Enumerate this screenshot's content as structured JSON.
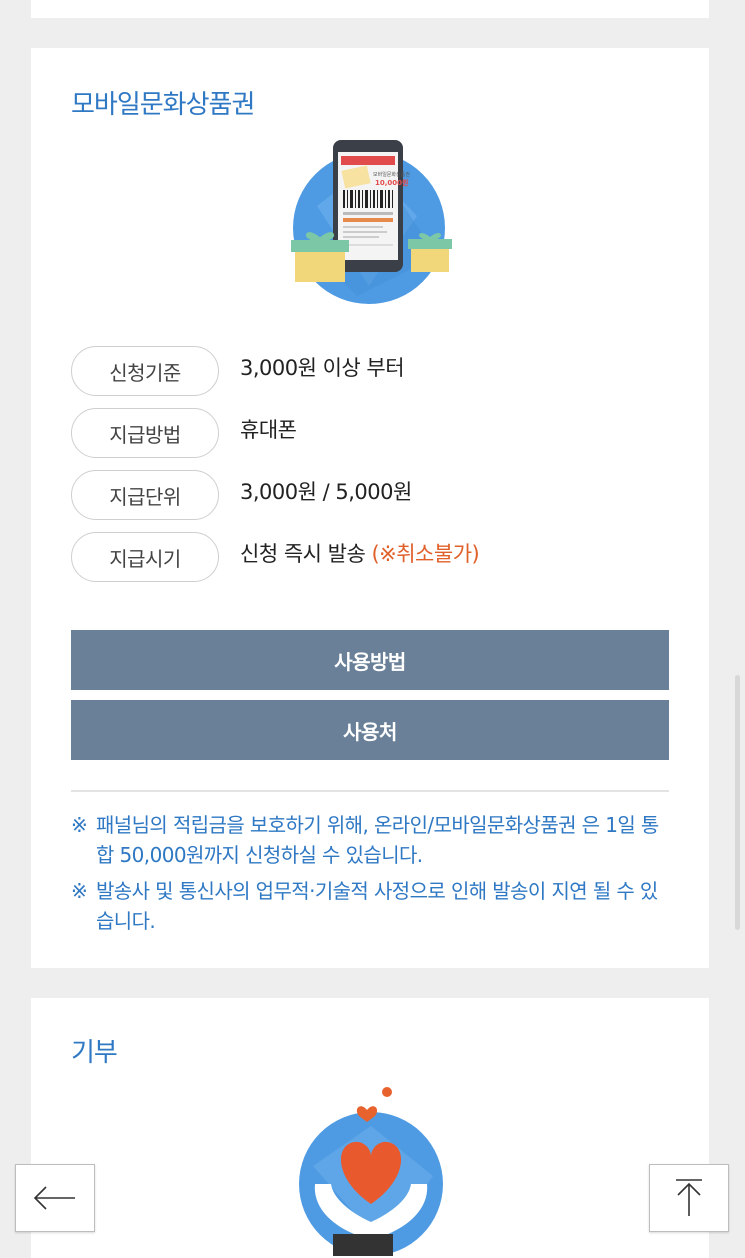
{
  "mobile_gift": {
    "title": "모바일문화상품권",
    "illustration": {
      "icon": "mobile-voucher-illustration",
      "voucher_amount": "10,000원"
    },
    "info": [
      {
        "label": "신청기준",
        "value": "3,000원 이상 부터",
        "note": ""
      },
      {
        "label": "지급방법",
        "value": "휴대폰",
        "note": ""
      },
      {
        "label": "지급단위",
        "value": "3,000원 / 5,000원",
        "note": ""
      },
      {
        "label": "지급시기",
        "value": "신청 즉시 발송 ",
        "note": "(※취소불가)"
      }
    ],
    "buttons": {
      "how_to_use": "사용방법",
      "where_to_use": "사용처"
    },
    "notices": [
      {
        "mark": "※",
        "text": "패널님의 적립금을 보호하기 위해, 온라인/모바일문화상품권 은 1일 통합 50,000원까지 신청하실 수 있습니다."
      },
      {
        "mark": "※",
        "text": "발송사 및 통신사의 업무적·기술적 사정으로 인해 발송이 지연 될 수 있습니다."
      }
    ]
  },
  "donation": {
    "title": "기부",
    "illustration": {
      "icon": "heart-hands-illustration"
    }
  },
  "nav": {
    "back_icon": "arrow-left-icon",
    "top_icon": "scroll-top-icon"
  },
  "colors": {
    "accent_blue": "#2f78c4",
    "button_bg": "#6a8098",
    "warning_orange": "#e0602a",
    "page_bg": "#eeeeee"
  }
}
